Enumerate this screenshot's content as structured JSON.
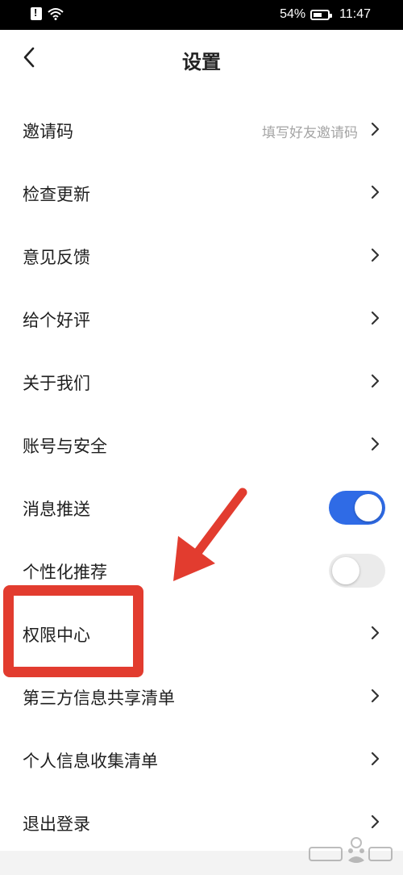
{
  "status_bar": {
    "battery": "54%",
    "time": "11:47",
    "icons": [
      "sim-alert-icon",
      "wifi-icon",
      "battery-icon"
    ]
  },
  "header": {
    "title": "设置",
    "back_icon": "chevron-left-icon"
  },
  "rows": [
    {
      "label": "邀请码",
      "hint": "填写好友邀请码"
    },
    {
      "label": "检查更新"
    },
    {
      "label": "意见反馈"
    },
    {
      "label": "给个好评"
    },
    {
      "label": "关于我们"
    },
    {
      "label": "账号与安全"
    },
    {
      "label": "消息推送",
      "toggle": true
    },
    {
      "label": "个性化推荐",
      "toggle": false
    },
    {
      "label": "权限中心"
    },
    {
      "label": "第三方信息共享清单"
    },
    {
      "label": "个人信息收集清单"
    },
    {
      "label": "退出登录"
    }
  ],
  "colors": {
    "toggle_on": "#2f6be6",
    "toggle_off": "#ebebeb",
    "annotation": "#e23c2f"
  }
}
